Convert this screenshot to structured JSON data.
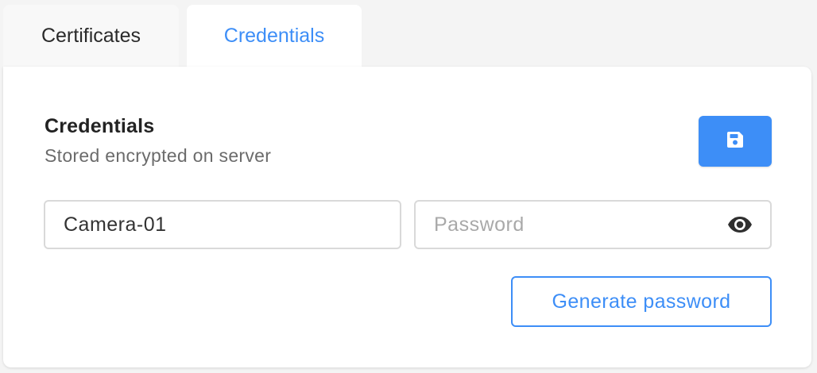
{
  "tabs": [
    {
      "label": "Certificates",
      "active": false
    },
    {
      "label": "Credentials",
      "active": true
    }
  ],
  "panel": {
    "title": "Credentials",
    "subtitle": "Stored encrypted on server",
    "save_icon": "floppy-disk-icon"
  },
  "form": {
    "username_value": "Camera-01",
    "password_value": "",
    "password_placeholder": "Password",
    "visibility_icon": "eye-icon",
    "generate_label": "Generate password"
  },
  "colors": {
    "accent": "#3d8ef7",
    "background": "#f4f4f4",
    "panel": "#ffffff",
    "border": "#d9d9d9"
  }
}
